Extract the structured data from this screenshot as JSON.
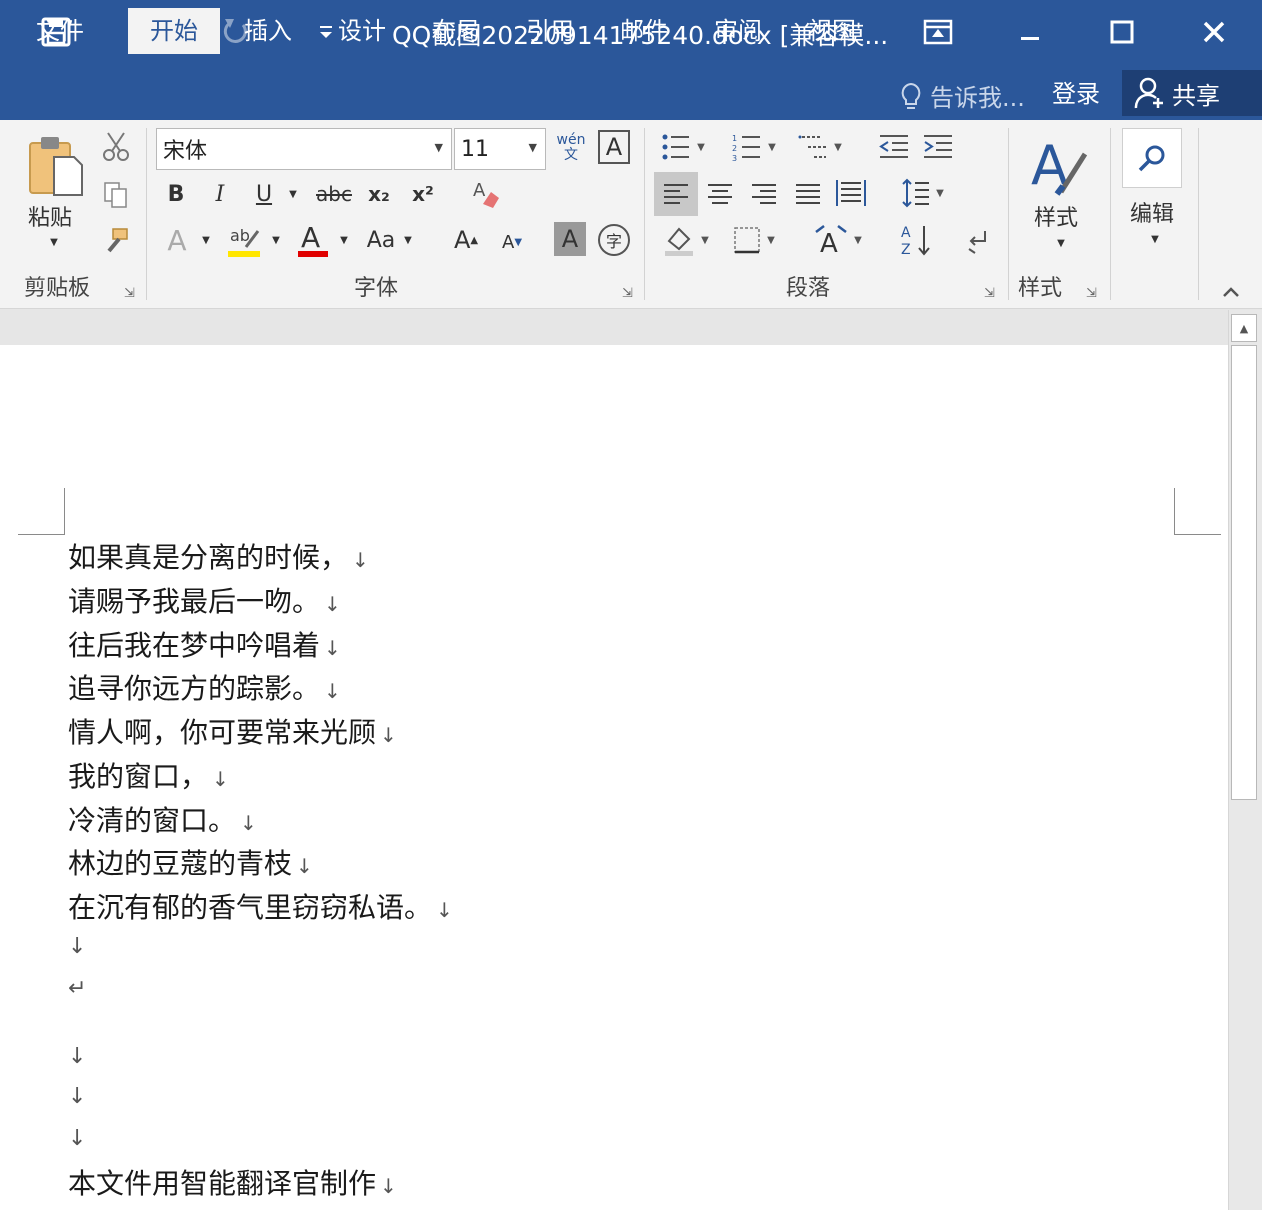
{
  "titlebar": {
    "title": "QQ截图20220914175240.docx [兼容模...",
    "save_icon": "save-icon",
    "undo_icon": "undo-icon",
    "redo_icon": "redo-icon",
    "customize_icon": "customize-qat-icon",
    "ribbon_display_icon": "ribbon-display-options-icon",
    "minimize_icon": "minimize-icon",
    "maximize_icon": "maximize-icon",
    "close_icon": "close-icon"
  },
  "tabs": [
    {
      "label": "文件"
    },
    {
      "label": "开始",
      "active": true
    },
    {
      "label": "插入"
    },
    {
      "label": "设计"
    },
    {
      "label": "布局"
    },
    {
      "label": "引用"
    },
    {
      "label": "邮件"
    },
    {
      "label": "审阅"
    },
    {
      "label": "视图"
    }
  ],
  "tell_me": "告诉我...",
  "login": "登录",
  "share": "共享",
  "ribbon": {
    "clipboard": {
      "paste": "粘贴",
      "label": "剪贴板"
    },
    "font": {
      "name": "宋体",
      "size": "11",
      "bold": "B",
      "italic": "I",
      "underline": "U",
      "strike": "abc",
      "subscript": "x₂",
      "superscript": "x²",
      "change_case": "Aa",
      "grow": "A",
      "shrink": "A",
      "pinyin": "wén",
      "pinyin_char": "文",
      "label": "字体"
    },
    "paragraph": {
      "label": "段落"
    },
    "styles": {
      "button": "样式",
      "label": "样式"
    },
    "editing": {
      "button": "编辑"
    }
  },
  "document": {
    "lines": [
      "如果真是分离的时候，",
      "请赐予我最后一吻。",
      "往后我在梦中吟唱着",
      "追寻你远方的踪影。",
      "情人啊，你可要常来光顾",
      "我的窗口，",
      "冷清的窗口。",
      "林边的豆蔻的青枝",
      "在沉有郁的香气里窃窃私语。"
    ],
    "footer_line": "本文件用智能翻译官制作",
    "line_break_mark": "↓",
    "paragraph_mark": "↵"
  }
}
